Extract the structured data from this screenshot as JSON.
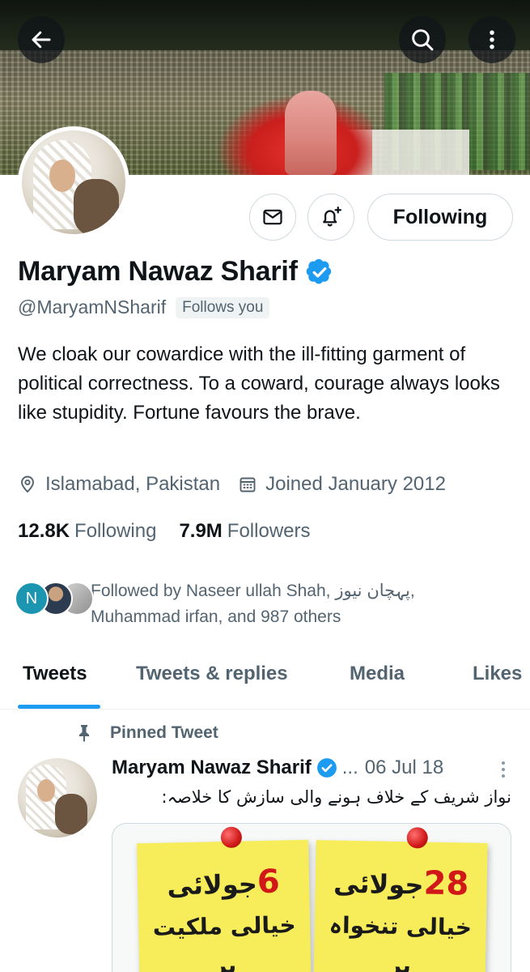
{
  "header": {
    "back_icon": "arrow-left-icon",
    "search_icon": "search-icon",
    "more_icon": "more-vertical-icon"
  },
  "profile": {
    "name": "Maryam Nawaz Sharif",
    "handle": "@MaryamNSharif",
    "follows_you": "Follows you",
    "verified": true,
    "bio": "We cloak our cowardice with the ill-fitting garment of political correctness. To a coward, courage always looks like stupidity. Fortune favours the brave.",
    "location": "Islamabad, Pakistan",
    "joined": "Joined January 2012",
    "following_count": "12.8K",
    "following_label": "Following",
    "followers_count": "7.9M",
    "followers_label": "Followers",
    "followed_by_line1": "Followed by Naseer ullah Shah, پہچان نیوز,",
    "followed_by_line2": "Muhammad irfan, and 987 others",
    "mini_avatar_initial": "N"
  },
  "actions": {
    "message_icon": "mail-icon",
    "notify_icon": "bell-plus-icon",
    "follow_label": "Following"
  },
  "tabs": [
    {
      "label": "Tweets",
      "active": true
    },
    {
      "label": "Tweets & replies",
      "active": false
    },
    {
      "label": "Media",
      "active": false
    },
    {
      "label": "Likes",
      "active": false
    }
  ],
  "pinned": {
    "label": "Pinned Tweet",
    "author": "Maryam Nawaz Sharif",
    "ellipsis": "...",
    "date": "06 Jul 18",
    "text": "نواز شریف کے خلاف ہونے والی سازش کا خلاصہ:",
    "notes": [
      {
        "number": "6",
        "line1": "جولائی",
        "line2": "خیالی ملکیت",
        "line3": "پر"
      },
      {
        "number": "28",
        "line1": "جولائی",
        "line2": "خیالی تنخواہ",
        "line3": "پر"
      }
    ]
  },
  "colors": {
    "accent": "#1d9bf0",
    "text_primary": "#0f1419",
    "text_secondary": "#536471",
    "border": "#cfd9de"
  }
}
